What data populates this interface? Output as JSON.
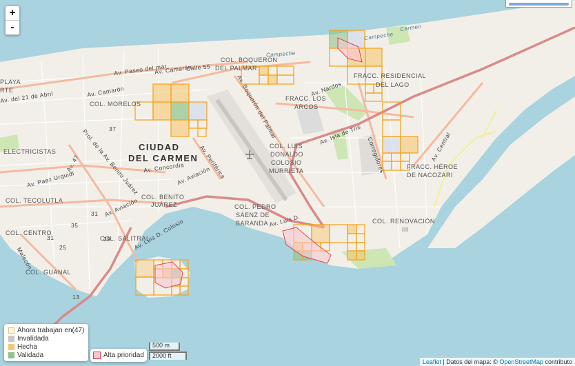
{
  "map": {
    "labels": {
      "city": [
        "CIUDAD",
        "DEL CARMEN"
      ],
      "neighborhoods": [
        "COL. BOQUERÓN",
        "DEL PALMAR",
        "FRACC. RESIDENCIAL",
        "DEL LAGO",
        "FRACC. LOS",
        "ARCOS",
        "COL. MORELOS",
        "PLAYA",
        "RTE",
        "ELECTRICISTAS",
        "COL. LUIS",
        "DONALDO",
        "COLOSIO",
        "MURRIETA",
        "FRACC. HÉROE",
        "DE NACOZARI",
        "COL. TECOLUTLA",
        "COL. BENITO",
        "JUÁREZ",
        "COL. PEDRO",
        "SÁENZ DE",
        "BARANDA",
        "COL. RENOVACIÓN",
        "III",
        "COL. CENTRO",
        "COL. SALITRAL",
        "COL. GUANAL"
      ],
      "streets": [
        "Av. Paseo del mar",
        "Av. Camarón",
        "Calle 55",
        "Av. Nardos",
        "Av. Isla de Tris",
        "Av. Boquerón del Palmar",
        "Av. Camarón",
        "Prol. de la Av. Benito Juárez",
        "Av. Concordia",
        "Av. Aviación",
        "Av. Periférica",
        "Av. Paez Urquidi",
        "Av. 47",
        "Av. Aviación",
        "Av. Luis D. Colosio",
        "Av. Luis D.",
        "Corregidores",
        "Av. Central",
        "Av. del 21 de Abril",
        "Malecón",
        "Campeche",
        "Carmen"
      ],
      "numbers": [
        "37",
        "31",
        "35",
        "29",
        "31",
        "25",
        "13"
      ]
    },
    "water_labels": [
      "Campeche",
      "Campeche",
      "Carmen"
    ]
  },
  "zoom": {
    "in": "+",
    "out": "-"
  },
  "legend": {
    "items": [
      {
        "label": "Ahora trabajan en(47)",
        "color": "#fff5dc",
        "border": "#e8c070"
      },
      {
        "label": "Invalidada",
        "color": "#c8c8c8",
        "border": "#c8c8c8"
      },
      {
        "label": "Hecha",
        "color": "#f7c872",
        "border": "#f7c872"
      },
      {
        "label": "Validada",
        "color": "#8fc58a",
        "border": "#8fc58a"
      }
    ]
  },
  "priority": {
    "label": "Alta prioridad"
  },
  "scale": {
    "metric": "500 m",
    "imperial": "2000 ft"
  },
  "attribution": {
    "leaflet": "Leaflet",
    "text": " | Datos del mapa: © ",
    "osm": "OpenStreetMap",
    "suffix": " contributo"
  },
  "colors": {
    "water": "#a9d3de",
    "land": "#f2efe9",
    "road": "#f9b29c",
    "highway": "#e28c8c",
    "tile_border": "#f5a623",
    "tile_done": "#f7c872",
    "tile_valid": "#8fc58a"
  }
}
